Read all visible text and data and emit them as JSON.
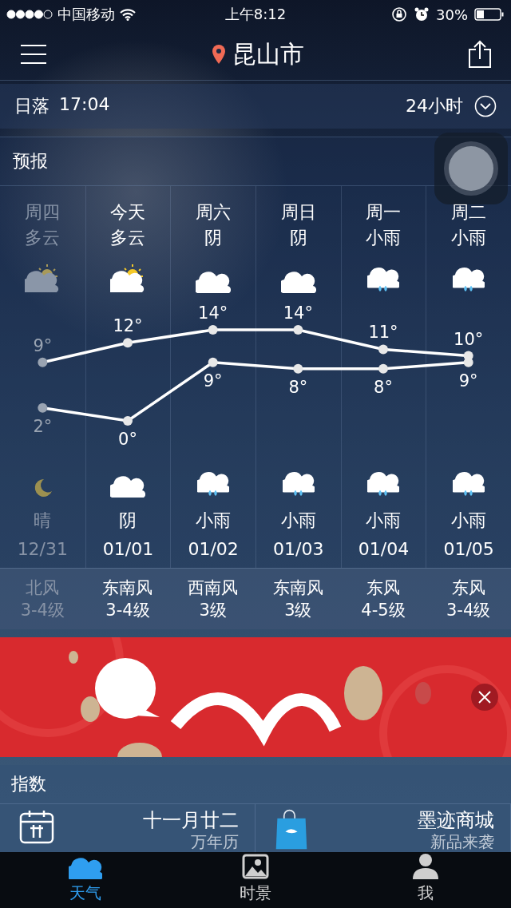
{
  "status_bar": {
    "carrier": "中国移动",
    "time": "上午8:12",
    "battery": "30%"
  },
  "nav": {
    "city": "昆山市"
  },
  "sun_row": {
    "label": "日落",
    "time": "17:04",
    "toggle": "24小时"
  },
  "forecast": {
    "title": "预报",
    "days": [
      {
        "day": "周四",
        "weather": "多云",
        "kind": "partly_cloudy",
        "night": {
          "kind": "moon",
          "weather": "晴"
        },
        "date": "12/31",
        "wind": "北风",
        "wind_level": "3-4级",
        "past": true
      },
      {
        "day": "今天",
        "weather": "多云",
        "kind": "partly_cloudy",
        "night": {
          "kind": "cloudy",
          "weather": "阴"
        },
        "date": "01/01",
        "wind": "东南风",
        "wind_level": "3-4级",
        "past": false
      },
      {
        "day": "周六",
        "weather": "阴",
        "kind": "cloudy",
        "night": {
          "kind": "light_rain",
          "weather": "小雨"
        },
        "date": "01/02",
        "wind": "西南风",
        "wind_level": "3级",
        "past": false
      },
      {
        "day": "周日",
        "weather": "阴",
        "kind": "cloudy",
        "night": {
          "kind": "light_rain",
          "weather": "小雨"
        },
        "date": "01/03",
        "wind": "东南风",
        "wind_level": "3级",
        "past": false
      },
      {
        "day": "周一",
        "weather": "小雨",
        "kind": "light_rain",
        "night": {
          "kind": "light_rain",
          "weather": "小雨"
        },
        "date": "01/04",
        "wind": "东风",
        "wind_level": "4-5级",
        "past": false
      },
      {
        "day": "周二",
        "weather": "小雨",
        "kind": "light_rain",
        "night": {
          "kind": "light_rain",
          "weather": "小雨"
        },
        "date": "01/05",
        "wind": "东风",
        "wind_level": "3-4级",
        "past": false
      }
    ],
    "chart_data": {
      "type": "line",
      "categories": [
        null,
        null,
        null,
        null,
        null,
        null
      ],
      "data_labels": true,
      "series": [
        {
          "color": "#ffffff",
          "marker": true,
          "values": [
            9,
            12,
            14,
            14,
            11,
            10
          ],
          "value_labels": [
            "9°",
            "12°",
            "14°",
            "14°",
            "11°",
            "10°"
          ]
        },
        {
          "color": "#ffffff",
          "marker": true,
          "values": [
            2,
            0,
            9,
            8,
            8,
            9
          ],
          "value_labels": [
            "2°",
            "0°",
            "9°",
            "8°",
            "8°",
            "9°"
          ]
        }
      ]
    }
  },
  "index": {
    "title": "指数",
    "cards": [
      {
        "kind": "calendar",
        "title": "十一月廿二",
        "subtitle": "万年历"
      },
      {
        "kind": "shop",
        "title": "墨迹商城",
        "subtitle": "新品来袭"
      }
    ]
  },
  "tab_bar": [
    {
      "label": "天气",
      "kind": "weather",
      "selected": true
    },
    {
      "label": "时景",
      "selected": false
    },
    {
      "label": "我",
      "kind": "me",
      "selected": false
    }
  ]
}
